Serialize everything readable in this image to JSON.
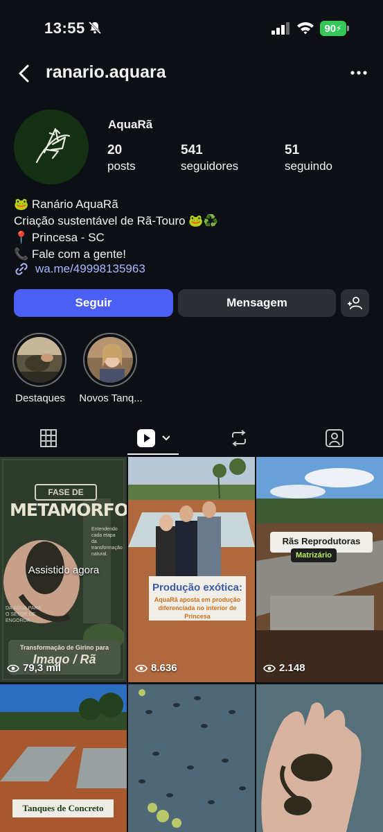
{
  "status_bar": {
    "time": "13:55",
    "battery": "90"
  },
  "header": {
    "username": "ranario.aquara"
  },
  "profile": {
    "display_name": "AquaRã",
    "stats": [
      {
        "value": "20",
        "label": "posts"
      },
      {
        "value": "541",
        "label": "seguidores"
      },
      {
        "value": "51",
        "label": "seguindo"
      }
    ],
    "bio": [
      "🐸 Ranário AquaRã",
      "Criação sustentável de Rã-Touro 🐸♻️",
      "📍 Princesa - SC",
      "📞 Fale com a gente!"
    ],
    "link": "wa.me/49998135963"
  },
  "buttons": {
    "follow": "Seguir",
    "message": "Mensagem"
  },
  "highlights": [
    {
      "label": "Destaques"
    },
    {
      "label": "Novos Tanq..."
    }
  ],
  "grid": {
    "posts": [
      {
        "views": "79,3 mil",
        "overlay": "Assistido agora",
        "title_top": "FASE DE",
        "title_main": "METAMORFOSE:",
        "side_text": "Entendendo cada etapa da transformação natural.",
        "badge_text": "DA ÁGUA PARA O SETOR DE ENGORDA",
        "caption_small": "Transformação de Girino para",
        "caption_big": "Imago / Rã"
      },
      {
        "views": "8.636",
        "headline": "Produção exótica:",
        "sub": "AquaRã aposta em produção diferenciada no interior de Princesa"
      },
      {
        "views": "2.148",
        "label": "Rãs Reprodutoras",
        "sublabel": "Matrizário"
      },
      {
        "label": "Tanques de Concreto"
      },
      {},
      {}
    ]
  }
}
